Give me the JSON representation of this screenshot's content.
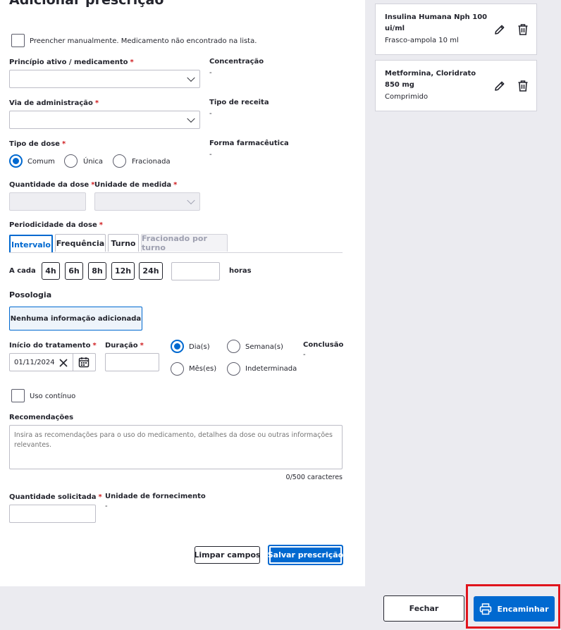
{
  "form": {
    "title": "Adicionar prescrição",
    "manual_fill_label": "Preencher manualmente. Medicamento não encontrado na lista.",
    "principio_label": "Princípio ativo / medicamento",
    "concentracao_label": "Concentração",
    "concentracao_value": "-",
    "via_label": "Via de administração",
    "tipo_receita_label": "Tipo de receita",
    "tipo_receita_value": "-",
    "tipo_dose_label": "Tipo de dose",
    "forma_label": "Forma farmacêutica",
    "forma_value": "-",
    "dose_options": [
      {
        "label": "Comum",
        "selected": true
      },
      {
        "label": "Única",
        "selected": false
      },
      {
        "label": "Fracionada",
        "selected": false
      }
    ],
    "quantidade_dose_label": "Quantidade da dose",
    "unidade_medida_label": "Unidade de medida",
    "periodicidade_label": "Periodicidade da dose",
    "tabs": [
      {
        "label": "Intervalo"
      },
      {
        "label": "Frequência"
      },
      {
        "label": "Turno"
      },
      {
        "label": "Fracionado por turno"
      }
    ],
    "a_cada_label": "A cada",
    "interval_chips": [
      "4h",
      "6h",
      "8h",
      "12h",
      "24h"
    ],
    "horas_label": "horas",
    "posologia_label": "Posologia",
    "posologia_empty": "Nenhuma informação adicionada",
    "inicio_label": "Início do tratamento",
    "inicio_value": "01/11/2024",
    "duracao_label": "Duração",
    "duration_units": [
      {
        "label": "Dia(s)",
        "selected": true
      },
      {
        "label": "Semana(s)",
        "selected": false
      },
      {
        "label": "Mês(es)",
        "selected": false
      },
      {
        "label": "Indeterminada",
        "selected": false
      }
    ],
    "conclusao_label": "Conclusão",
    "conclusao_value": "-",
    "uso_continuo_label": "Uso contínuo",
    "recomendacoes_label": "Recomendações",
    "recomendacoes_placeholder": "Insira as recomendações para o uso do medicamento, detalhes da dose ou outras informações relevantes.",
    "char_counter": "0/500 caracteres",
    "quantidade_solicitada_label": "Quantidade solicitada",
    "unidade_fornecimento_label": "Unidade de fornecimento",
    "unidade_fornecimento_value": "-",
    "limpar_label": "Limpar campos",
    "salvar_label": "Salvar prescrição"
  },
  "prescriptions": [
    {
      "name": "Insulina Humana Nph 100 ui/ml",
      "form": "Frasco-ampola 10 ml"
    },
    {
      "name": "Metformina, Cloridrato 850 mg",
      "form": "Comprimido"
    }
  ],
  "footer": {
    "fechar_label": "Fechar",
    "encaminhar_label": "Encaminhar"
  },
  "colors": {
    "primary": "#0069d0",
    "required": "#d01c1f",
    "highlight": "#e0141c"
  }
}
